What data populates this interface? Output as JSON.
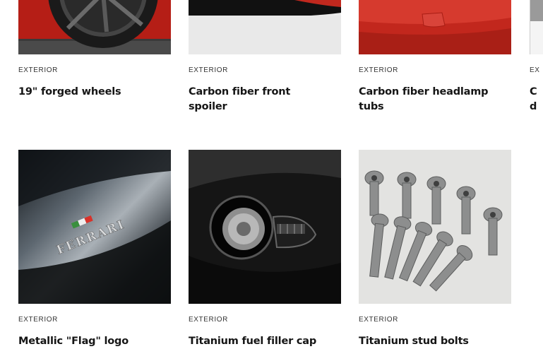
{
  "products": [
    {
      "category": "EXTERIOR",
      "title": "19\" forged wheels",
      "image_icon": "wheel-image"
    },
    {
      "category": "EXTERIOR",
      "title": "Carbon fiber front spoiler",
      "image_icon": "spoiler-image"
    },
    {
      "category": "EXTERIOR",
      "title": "Carbon fiber headlamp tubs",
      "image_icon": "headlamp-image"
    },
    {
      "category": "EX",
      "title": "C d",
      "image_icon": "partial-image"
    },
    {
      "category": "EXTERIOR",
      "title": "Metallic \"Flag\" logo",
      "image_icon": "logo-image",
      "logo_text": "FERRARI"
    },
    {
      "category": "EXTERIOR",
      "title": "Titanium fuel filler cap",
      "image_icon": "fuel-cap-image"
    },
    {
      "category": "EXTERIOR",
      "title": "Titanium stud bolts",
      "image_icon": "bolts-image"
    }
  ],
  "colors": {
    "red": "#c0281e",
    "dark": "#111111",
    "text": "#151515"
  }
}
